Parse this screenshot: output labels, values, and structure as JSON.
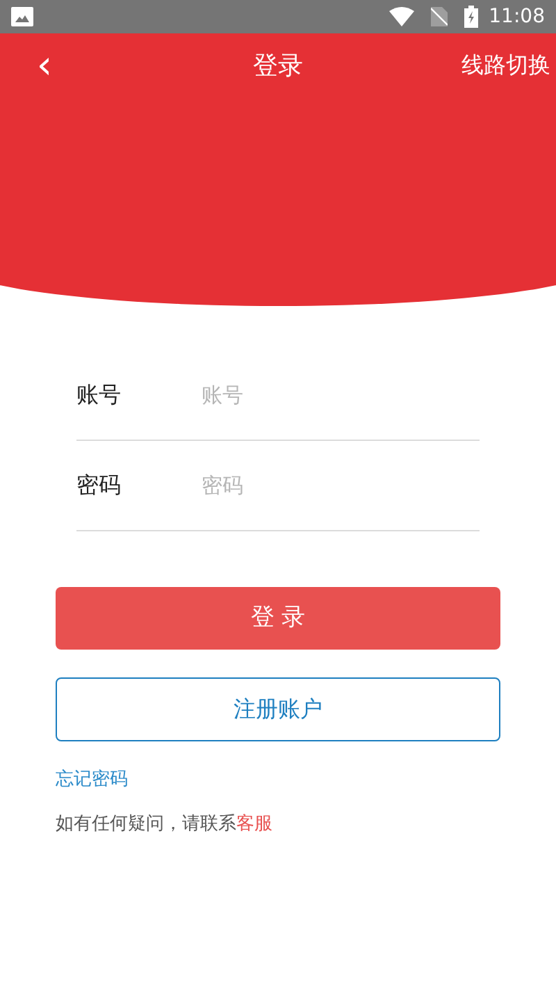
{
  "status_bar": {
    "time": "11:08"
  },
  "header": {
    "back": "‹",
    "title": "登录",
    "action": "线路切换"
  },
  "fields": [
    {
      "label": "账号",
      "placeholder": "账号"
    },
    {
      "label": "密码",
      "placeholder": "密码"
    }
  ],
  "login_button": "登 录",
  "register_button": "注册账户",
  "forgot_link": "忘记密码",
  "help": {
    "text": "如有任何疑问，请联系",
    "link": "客服"
  }
}
